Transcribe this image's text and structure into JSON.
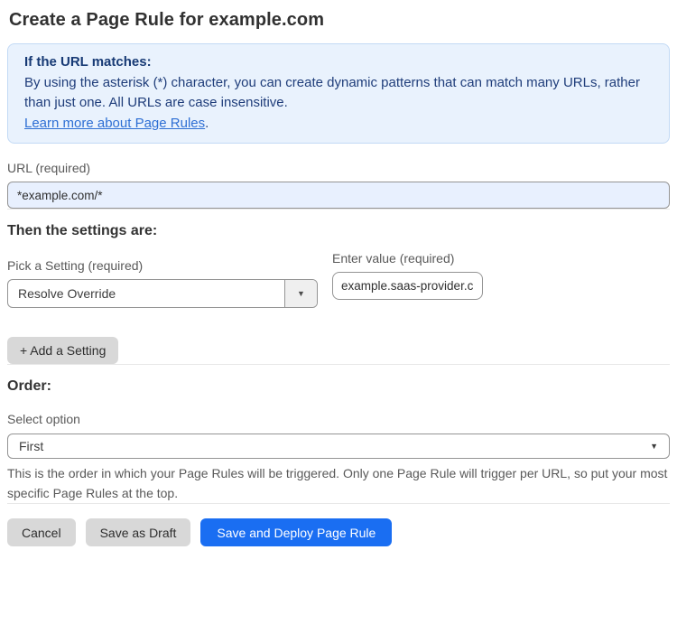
{
  "page": {
    "title": "Create a Page Rule for example.com"
  },
  "info_box": {
    "heading": "If the URL matches:",
    "body": "By using the asterisk (*) character, you can create dynamic patterns that can match many URLs, rather than just one. All URLs are case insensitive.",
    "link_label": "Learn more about Page Rules",
    "link_suffix": "."
  },
  "url_field": {
    "label": "URL (required)",
    "value": "*example.com/*"
  },
  "settings": {
    "heading": "Then the settings are:",
    "setting_select": {
      "label": "Pick a Setting (required)",
      "value": "Resolve Override"
    },
    "value_field": {
      "label": "Enter value (required)",
      "value": "example.saas-provider.c"
    },
    "add_button_label": "+ Add a Setting"
  },
  "order": {
    "heading": "Order:",
    "select_label": "Select option",
    "select_value": "First",
    "help_text": "This is the order in which your Page Rules will be triggered. Only one Page Rule will trigger per URL, so put your most specific Page Rules at the top."
  },
  "actions": {
    "cancel_label": "Cancel",
    "save_draft_label": "Save as Draft",
    "save_deploy_label": "Save and Deploy Page Rule"
  },
  "icons": {
    "dropdown_arrow": "▼"
  },
  "colors": {
    "info_box_bg": "#e9f2fd",
    "info_box_text": "#1f3d7a",
    "link_blue": "#2e6fd4",
    "autofill_input_bg": "#e8f0fe",
    "primary_button_bg": "#1a6ef2",
    "gray_button_bg": "#d8d8d8"
  }
}
